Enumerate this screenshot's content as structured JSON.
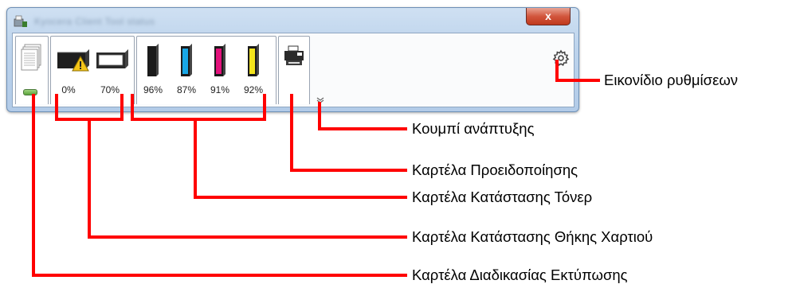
{
  "window": {
    "title": "Kyocera Client Tool status",
    "close_label": "x"
  },
  "tabs": {
    "paper_cassettes": [
      {
        "level": "0%",
        "warning": true
      },
      {
        "level": "70%",
        "warning": false
      }
    ],
    "toners": [
      {
        "color": "black",
        "hex": "#1b1b1b",
        "level": "96%"
      },
      {
        "color": "cyan",
        "hex": "#19a7e6",
        "level": "87%"
      },
      {
        "color": "magenta",
        "hex": "#e3127c",
        "level": "91%"
      },
      {
        "color": "yellow",
        "hex": "#f2e31c",
        "level": "92%"
      }
    ]
  },
  "icons": {
    "job": "stacked-pages-icon",
    "warning": "warning-triangle-icon",
    "alert": "printer-icon",
    "expand": "chevron-down-icon",
    "settings": "gear-icon"
  },
  "callouts": {
    "settings": "Εικονίδιο ρυθμίσεων",
    "expand": "Κουμπί ανάπτυξης",
    "alert": "Καρτέλα Προειδοποίησης",
    "toner": "Καρτέλα Κατάστασης Τόνερ",
    "paper": "Καρτέλα Κατάστασης Θήκης Χαρτιού",
    "job": "Καρτέλα Διαδικασίας Εκτύπωσης"
  },
  "colors": {
    "callout_line": "#ff0000",
    "close_button": "#c84a30"
  }
}
